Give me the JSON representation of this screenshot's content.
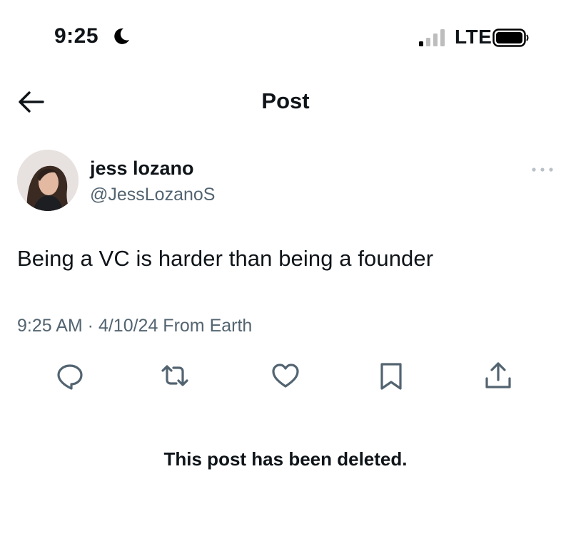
{
  "status_bar": {
    "time": "9:25",
    "network": "LTE",
    "icons": [
      "moon-icon",
      "signal-icon",
      "battery-icon"
    ]
  },
  "nav": {
    "title": "Post",
    "back_icon": "back-arrow-icon"
  },
  "post": {
    "author_name": "jess lozano",
    "author_handle": "@JessLozanoS",
    "text": "Being a VC is harder than being a founder",
    "timestamp": "9:25 AM · 4/10/24 From Earth",
    "more_icon": "more-options-icon",
    "actions": [
      "reply-icon",
      "repost-icon",
      "like-icon",
      "bookmark-icon",
      "share-icon"
    ]
  },
  "notice": "This post has been deleted.",
  "colors": {
    "text_primary": "#0f1419",
    "text_secondary": "#536471",
    "icon": "#536471",
    "background": "#ffffff"
  }
}
